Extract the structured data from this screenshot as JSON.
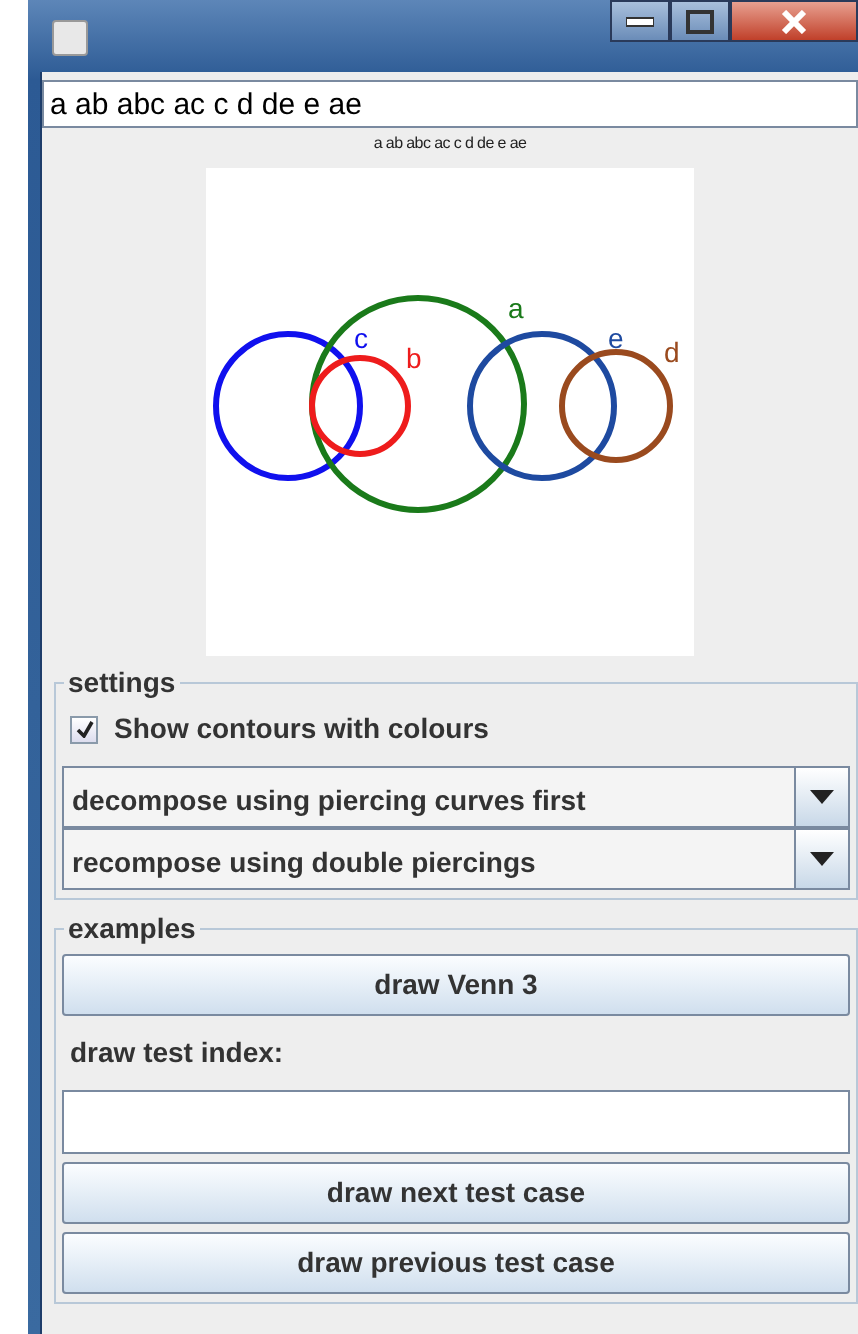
{
  "input": {
    "value": "a ab abc ac c d de e ae"
  },
  "caption": "a ab abc ac c d de e ae",
  "diagram": {
    "curves": [
      {
        "label": "c",
        "color": "#1010ee"
      },
      {
        "label": "a",
        "color": "#1a7a1a"
      },
      {
        "label": "b",
        "color": "#ee1c1c"
      },
      {
        "label": "e",
        "color": "#1e4aa0"
      },
      {
        "label": "d",
        "color": "#9a4a1e"
      }
    ]
  },
  "settings": {
    "title": "settings",
    "checkbox": {
      "label": "Show contours with colours",
      "checked": true
    },
    "dropdowns": [
      {
        "value": "decompose using piercing curves first"
      },
      {
        "value": "recompose using double piercings"
      }
    ]
  },
  "examples": {
    "title": "examples",
    "venn_button": "draw Venn 3",
    "index_label": "draw test index:",
    "buttons": [
      "draw next test case",
      "draw previous test case"
    ]
  }
}
